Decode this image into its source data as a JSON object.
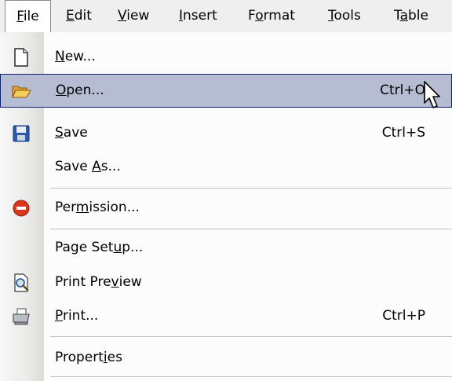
{
  "menubar": {
    "items": [
      {
        "label": "File",
        "accel": "F",
        "rest": "ile"
      },
      {
        "label": "Edit",
        "accel": "E",
        "rest": "dit"
      },
      {
        "label": "View",
        "accel": "V",
        "rest": "iew"
      },
      {
        "label": "Insert",
        "accel": "I",
        "rest": "nsert"
      },
      {
        "pre": "F",
        "accel": "o",
        "rest": "rmat"
      },
      {
        "label": "Tools",
        "accel": "T",
        "rest": "ools"
      },
      {
        "pre": "T",
        "accel": "a",
        "rest": "ble"
      }
    ]
  },
  "file_menu": {
    "new": {
      "accel": "N",
      "rest": "ew..."
    },
    "open": {
      "accel": "O",
      "rest": "pen...",
      "shortcut": "Ctrl+O"
    },
    "save": {
      "accel": "S",
      "rest": "ave",
      "shortcut": "Ctrl+S"
    },
    "save_as": {
      "pre": "Save ",
      "accel": "A",
      "rest": "s..."
    },
    "permission": {
      "pre": "Per",
      "accel": "m",
      "rest": "ission..."
    },
    "page_setup": {
      "pre": "Page Set",
      "accel": "u",
      "rest": "p..."
    },
    "print_preview": {
      "pre": "Print Pre",
      "accel": "v",
      "rest": "iew"
    },
    "print": {
      "accel": "P",
      "rest": "rint...",
      "shortcut": "Ctrl+P"
    },
    "properties": {
      "pre": "Propert",
      "accel": "i",
      "rest": "es"
    }
  },
  "colors": {
    "highlight_bg": "#b6bdd2",
    "highlight_border": "#0a246a",
    "permission_red": "#d9361c"
  }
}
